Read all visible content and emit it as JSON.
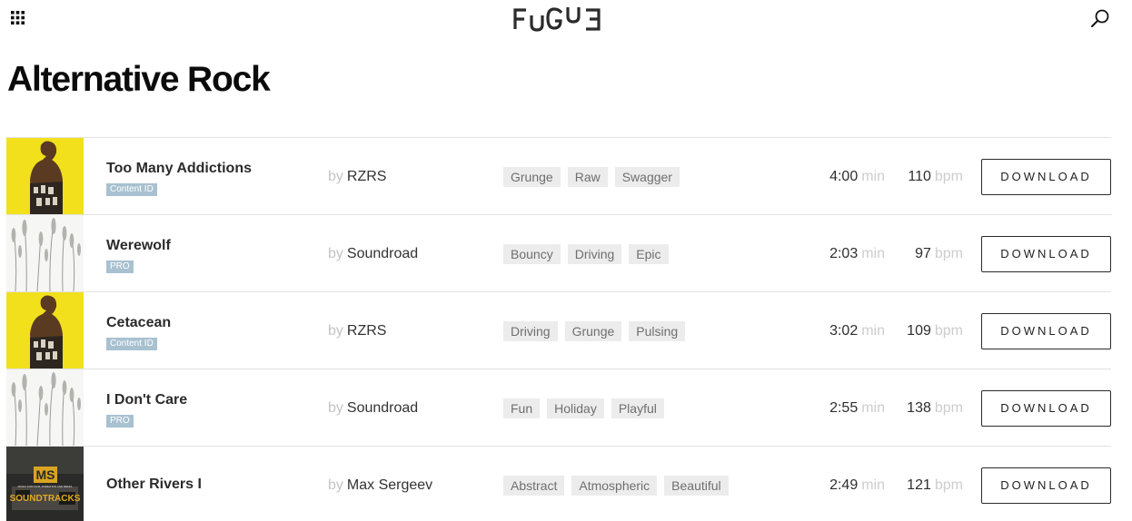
{
  "header": {
    "logo_text": "FUGUE",
    "menu_icon": "grid-menu-icon",
    "search_icon": "search-icon"
  },
  "page": {
    "title": "Alternative Rock"
  },
  "tracks": [
    {
      "title": "Too Many Addictions",
      "badge": "Content ID",
      "by": "by",
      "artist": "RZRS",
      "tags": [
        "Grunge",
        "Raw",
        "Swagger"
      ],
      "duration": "4:00",
      "duration_unit": "min",
      "bpm": "110",
      "bpm_unit": "bpm",
      "download_label": "DOWNLOAD",
      "cover": "yellow-figure-cover"
    },
    {
      "title": "Werewolf",
      "badge": "PRO",
      "by": "by",
      "artist": "Soundroad",
      "tags": [
        "Bouncy",
        "Driving",
        "Epic"
      ],
      "duration": "2:03",
      "duration_unit": "min",
      "bpm": "97",
      "bpm_unit": "bpm",
      "download_label": "DOWNLOAD",
      "cover": "wheat-cover"
    },
    {
      "title": "Cetacean",
      "badge": "Content ID",
      "by": "by",
      "artist": "RZRS",
      "tags": [
        "Driving",
        "Grunge",
        "Pulsing"
      ],
      "duration": "3:02",
      "duration_unit": "min",
      "bpm": "109",
      "bpm_unit": "bpm",
      "download_label": "DOWNLOAD",
      "cover": "yellow-figure-cover"
    },
    {
      "title": "I Don't Care",
      "badge": "PRO",
      "by": "by",
      "artist": "Soundroad",
      "tags": [
        "Fun",
        "Holiday",
        "Playful"
      ],
      "duration": "2:55",
      "duration_unit": "min",
      "bpm": "138",
      "bpm_unit": "bpm",
      "download_label": "DOWNLOAD",
      "cover": "wheat-cover"
    },
    {
      "title": "Other Rivers I",
      "badge": "",
      "by": "by",
      "artist": "Max Sergeev",
      "tags": [
        "Abstract",
        "Atmospheric",
        "Beautiful"
      ],
      "duration": "2:49",
      "duration_unit": "min",
      "bpm": "121",
      "bpm_unit": "bpm",
      "download_label": "DOWNLOAD",
      "cover": "ms-soundtracks-cover",
      "cover_text": {
        "ms": "MS",
        "soundtracks": "SOUNDTRACKS",
        "small": "MUSIC FOR FILM, ANIMATION AND MEDIA"
      }
    }
  ],
  "colors": {
    "cover_yellow": "#f2e01d",
    "badge": "#a8c1d0",
    "tag_bg": "#ececec",
    "muted_text": "#c4c4c4"
  }
}
